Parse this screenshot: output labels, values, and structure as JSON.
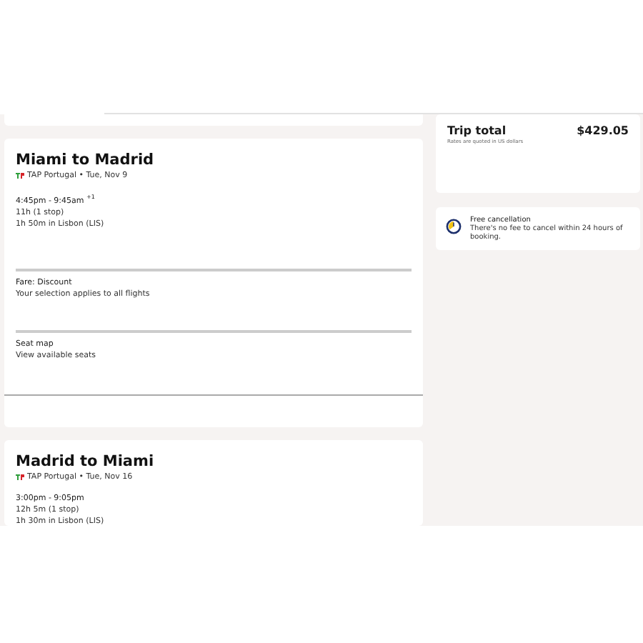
{
  "flights": [
    {
      "title": "Miami to Madrid",
      "airline": "TAP Portugal • Tue, Nov 9",
      "times": "4:45pm - 9:45am",
      "day_offset": "+1",
      "duration": "11h (1 stop)",
      "layover": "1h 50m in Lisbon (LIS)",
      "sections": [
        {
          "title": "Fare: Discount",
          "text": "Your selection applies to all flights"
        },
        {
          "title": "Seat map",
          "text": "View available seats"
        }
      ]
    },
    {
      "title": "Madrid to Miami",
      "airline": "TAP Portugal • Tue, Nov 16",
      "times": "3:00pm - 9:05pm",
      "duration": "12h 5m (1 stop)",
      "layover": "1h 30m in Lisbon (LIS)"
    }
  ],
  "summary": {
    "label": "Trip total",
    "amount": "$429.05",
    "note": "Rates are quoted in US dollars"
  },
  "cancellation": {
    "title": "Free cancellation",
    "text": "There's no fee to cancel within 24 hours of booking."
  }
}
